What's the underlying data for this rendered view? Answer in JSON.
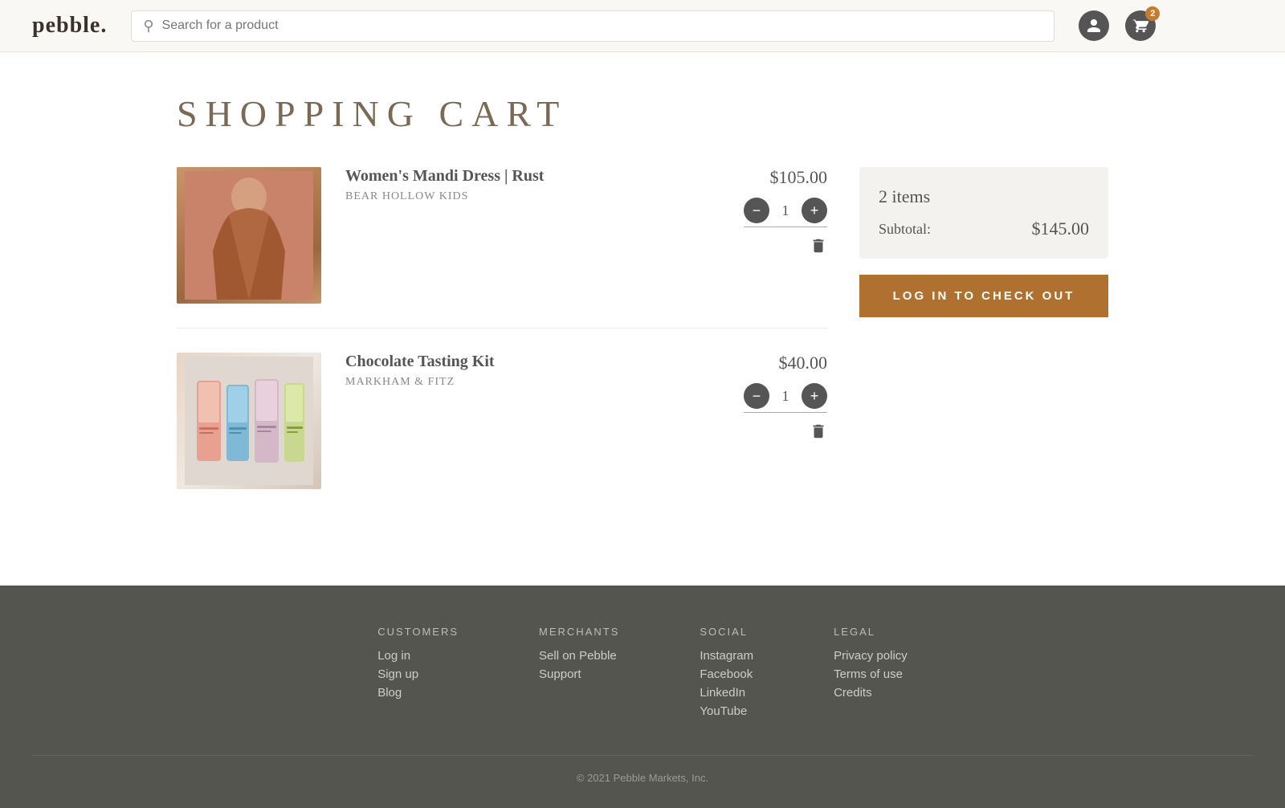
{
  "header": {
    "logo_text": "pebble.",
    "search_placeholder": "Search for a product",
    "cart_badge_count": "2"
  },
  "page": {
    "title": "SHOPPING CART"
  },
  "cart": {
    "items": [
      {
        "id": "item-1",
        "name": "Women's Mandi Dress | Rust",
        "brand": "Bear Hollow Kids",
        "price": "$105.00",
        "quantity": 1,
        "image_type": "dress"
      },
      {
        "id": "item-2",
        "name": "Chocolate Tasting Kit",
        "brand": "MARKHAM & FITZ",
        "price": "$40.00",
        "quantity": 1,
        "image_type": "chocolate"
      }
    ],
    "summary": {
      "items_count": "2 items",
      "subtotal_label": "Subtotal:",
      "subtotal_amount": "$145.00"
    },
    "checkout_button_label": "LOG IN TO CHECK OUT"
  },
  "footer": {
    "columns": [
      {
        "heading": "CUSTOMERS",
        "links": [
          "Log in",
          "Sign up",
          "Blog"
        ]
      },
      {
        "heading": "MERCHANTS",
        "links": [
          "Sell on Pebble",
          "Support"
        ]
      },
      {
        "heading": "SOCIAL",
        "links": [
          "Instagram",
          "Facebook",
          "LinkedIn",
          "YouTube"
        ]
      },
      {
        "heading": "LEGAL",
        "links": [
          "Privacy policy",
          "Terms of use",
          "Credits"
        ]
      }
    ],
    "copyright": "© 2021 Pebble Markets, Inc."
  }
}
